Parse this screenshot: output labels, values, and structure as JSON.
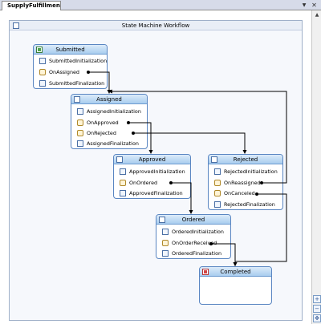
{
  "tab": {
    "title": "SupplyFulfillment.xoml"
  },
  "workflow": {
    "title": "State Machine Workflow"
  },
  "states": {
    "submitted": {
      "title": "Submitted",
      "rows": [
        "SubmittedInitialization",
        "OnAssigned",
        "SubmittedFinalization"
      ]
    },
    "assigned": {
      "title": "Assigned",
      "rows": [
        "AssignedInitialization",
        "OnApproved",
        "OnRejected",
        "AssignedFinalization"
      ]
    },
    "approved": {
      "title": "Approved",
      "rows": [
        "ApprovedInitialization",
        "OnOrdered",
        "ApprovedFinalization"
      ]
    },
    "rejected": {
      "title": "Rejected",
      "rows": [
        "RejectedInitialization",
        "OnReassigned",
        "OnCanceled",
        "RejectedFinalization"
      ]
    },
    "ordered": {
      "title": "Ordered",
      "rows": [
        "OrderedInitialization",
        "OnOrderReceived",
        "OrderedFinalization"
      ]
    },
    "completed": {
      "title": "Completed"
    }
  },
  "icons": {
    "close": "close-icon",
    "dropdown": "chevron-down-icon",
    "init": "state-initialization-icon",
    "event": "event-driven-icon",
    "final": "state-finalization-icon"
  },
  "colors": {
    "state_border": "#5a86c2",
    "state_header": "#a9cdef",
    "connector": "#000000"
  }
}
